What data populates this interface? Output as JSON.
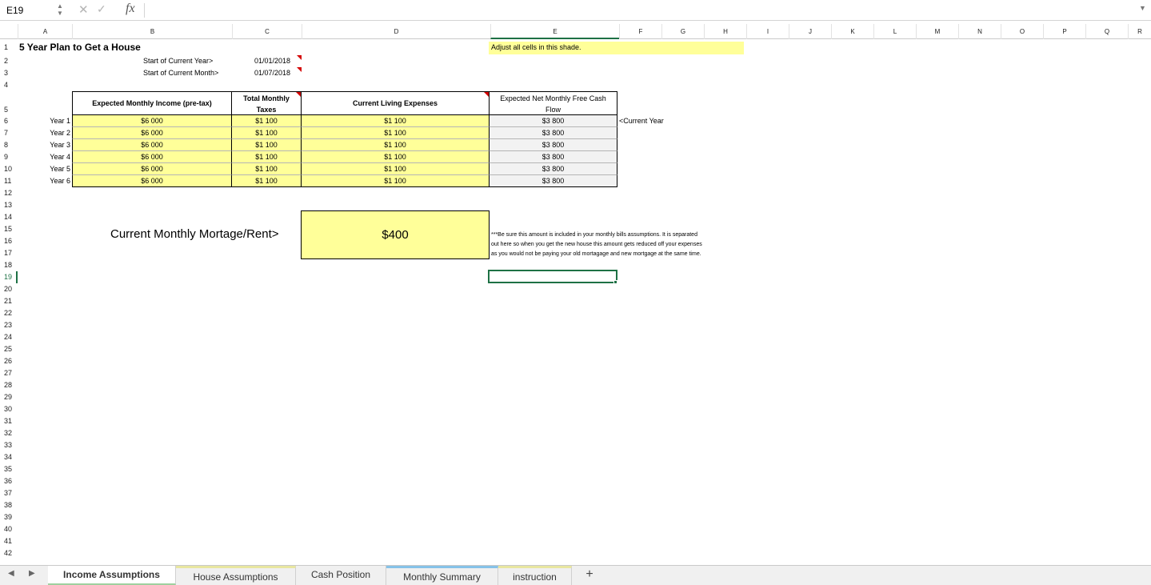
{
  "formula_bar": {
    "name_box": "E19",
    "fx": "fx",
    "content": ""
  },
  "columns": [
    "A",
    "B",
    "C",
    "D",
    "E",
    "F",
    "G",
    "H",
    "I",
    "J",
    "K",
    "L",
    "M",
    "N",
    "O",
    "P",
    "Q",
    "R"
  ],
  "rows": [
    "1",
    "2",
    "3",
    "4",
    "5",
    "6",
    "7",
    "8",
    "9",
    "10",
    "11",
    "12",
    "13",
    "14",
    "15",
    "16",
    "17",
    "18",
    "19",
    "20",
    "21",
    "22",
    "23",
    "24",
    "25",
    "26",
    "27",
    "28",
    "29",
    "30",
    "31",
    "32",
    "33",
    "34",
    "35",
    "36",
    "37",
    "38",
    "39",
    "40",
    "41",
    "42"
  ],
  "active_cell": "E19",
  "sheet": {
    "title": "5 Year Plan to Get a House",
    "hint": "Adjust all cells in this shade.",
    "start_year_label": "Start of Current Year>",
    "start_year_value": "01/01/2018",
    "start_month_label": "Start of Current Month>",
    "start_month_value": "01/07/2018",
    "table": {
      "headers": {
        "income": "Expected Monthly Income (pre-tax)",
        "taxes_l1": "Total Monthly",
        "taxes_l2": "Taxes",
        "expenses": "Current Living Expenses",
        "cash_l1": "Expected Net Monthly Free Cash",
        "cash_l2": "Flow"
      },
      "rows": [
        {
          "label": "Year 1",
          "income": "$6 000",
          "taxes": "$1 100",
          "expenses": "$1 100",
          "cash": "$3 800"
        },
        {
          "label": "Year 2",
          "income": "$6 000",
          "taxes": "$1 100",
          "expenses": "$1 100",
          "cash": "$3 800"
        },
        {
          "label": "Year 3",
          "income": "$6 000",
          "taxes": "$1 100",
          "expenses": "$1 100",
          "cash": "$3 800"
        },
        {
          "label": "Year 4",
          "income": "$6 000",
          "taxes": "$1 100",
          "expenses": "$1 100",
          "cash": "$3 800"
        },
        {
          "label": "Year 5",
          "income": "$6 000",
          "taxes": "$1 100",
          "expenses": "$1 100",
          "cash": "$3 800"
        },
        {
          "label": "Year 6",
          "income": "$6 000",
          "taxes": "$1 100",
          "expenses": "$1 100",
          "cash": "$3 800"
        }
      ],
      "current_year_marker": "<Current Year"
    },
    "mortgage_label": "Current Monthly Mortage/Rent>",
    "mortgage_value": "$400",
    "note_l1": "***Be sure this amount is included in your monthly bills assumptions. It is separated",
    "note_l2": "out here so when you get the new house this amount gets reduced off your expenses",
    "note_l3": "as you would not be paying your old mortagage and new mortgage at the same time."
  },
  "tabs": [
    "Income Assumptions",
    "House Assumptions",
    "Cash Position",
    "Monthly Summary",
    "instruction"
  ],
  "active_tab": "Income Assumptions",
  "add_tab_label": "+",
  "colors": {
    "input_shade": "#ffff99",
    "calc_shade": "#f2f2f2",
    "selection": "#1e7145"
  }
}
